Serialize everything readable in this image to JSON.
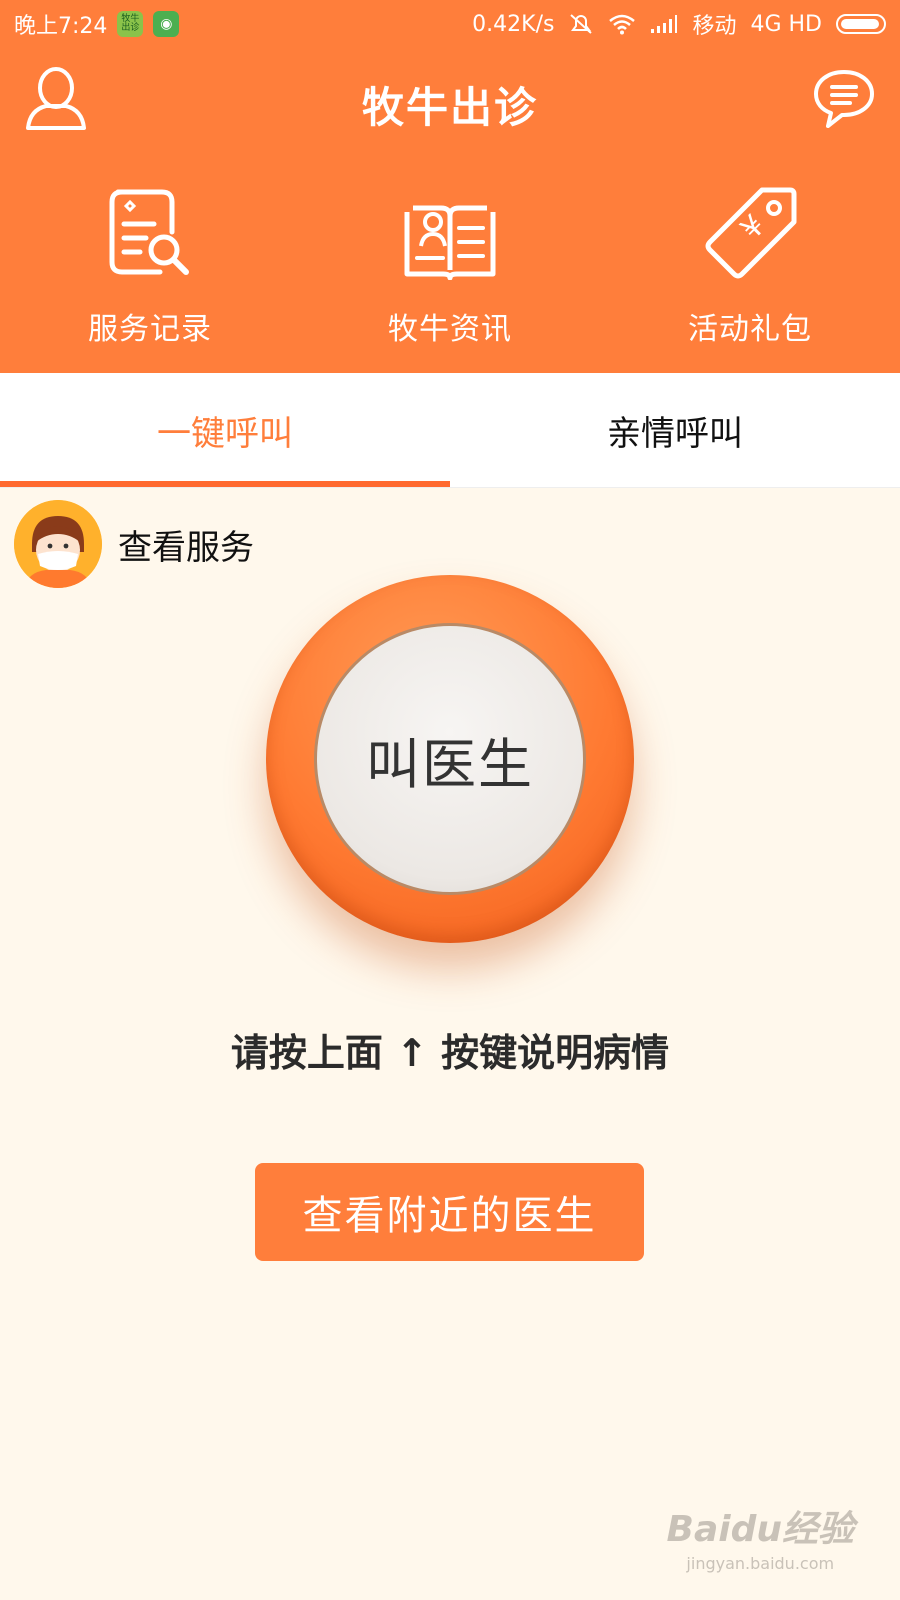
{
  "status_bar": {
    "time": "晚上7:24",
    "app_icon_1": "牧牛出诊",
    "speed": "0.42K/s",
    "carrier": "移动",
    "network": "4G HD"
  },
  "header": {
    "title": "牧牛出诊",
    "left_icon": "user-icon",
    "right_icon": "message-icon",
    "background": "#ff7e3b"
  },
  "quick_actions": [
    {
      "label": "服务记录",
      "icon": "service-record-icon"
    },
    {
      "label": "牧牛资讯",
      "icon": "news-book-icon"
    },
    {
      "label": "活动礼包",
      "icon": "price-tag-icon"
    }
  ],
  "tabs": [
    {
      "label": "一键呼叫",
      "active": true
    },
    {
      "label": "亲情呼叫",
      "active": false
    }
  ],
  "service": {
    "label": "查看服务"
  },
  "call_button": {
    "label": "叫医生"
  },
  "hint": "请按上面 ↑ 按键说明病情",
  "nearby_button": {
    "label": "查看附近的医生"
  },
  "watermark": {
    "main": "Baidu经验",
    "sub": "jingyan.baidu.com"
  }
}
